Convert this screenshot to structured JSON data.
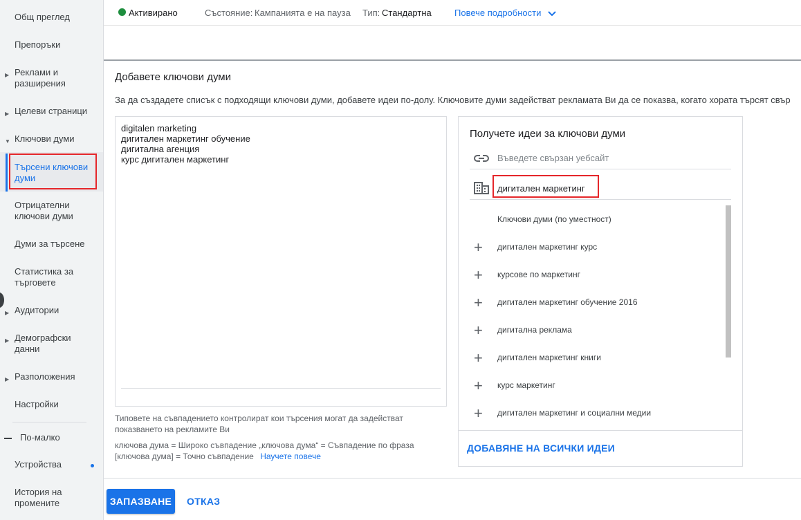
{
  "sidebar": {
    "items": [
      {
        "label": "Общ преглед"
      },
      {
        "label": "Препоръки"
      },
      {
        "label": "Реклами и разширения"
      },
      {
        "label": "Целеви страници"
      },
      {
        "label": "Ключови думи"
      },
      {
        "label": "Търсени ключови думи"
      },
      {
        "label": "Отрицателни ключови думи"
      },
      {
        "label": "Думи за търсене"
      },
      {
        "label": "Статистика за търговете"
      },
      {
        "label": "Аудитории"
      },
      {
        "label": "Демографски данни"
      },
      {
        "label": "Разположения"
      },
      {
        "label": "Настройки"
      },
      {
        "label": "По-малко"
      },
      {
        "label": "Устройства"
      },
      {
        "label": "История на промените"
      }
    ]
  },
  "status_bar": {
    "status": "Активирано",
    "state_label": "Състояние:",
    "state_value": "Кампанията е на пауза",
    "type_label": "Тип:",
    "type_value": "Стандартна",
    "more_details": "Повече подробности"
  },
  "main": {
    "title": "Добавете ключови думи",
    "description": "За да създадете списък с подходящи ключови думи, добавете идеи по-долу. Ключовите думи задействат рекламата Ви да се показва, когато хората търсят свър",
    "keywords": [
      "digitalen marketing",
      "дигитален маркетинг обучение",
      "дигитална агенция",
      "курс дигитален маркетинг"
    ],
    "help_text": "Типовете на съвпадението контролират кои търсения могат да задействат показването на рекламите Ви",
    "match_line1": "ключова дума = Широко съвпадение  „ключова дума“ = Съвпадение по фраза",
    "match_line2": "[ключова дума] = Точно съвпадение",
    "learn_more": "Научете повече"
  },
  "ideas_panel": {
    "title": "Получете идеи за ключови думи",
    "url_placeholder": "Въведете свързан уебсайт",
    "service_value": "дигитален маркетинг",
    "column_header": "Ключови думи (по уместност)",
    "ideas": [
      "дигитален маркетинг курс",
      "курсове по маркетинг",
      "дигитален маркетинг обучение 2016",
      "дигитална реклама",
      "дигитален маркетинг книги",
      "курс маркетинг",
      "дигитален маркетинг и социални медии"
    ],
    "add_all": "ДОБАВЯНЕ НА ВСИЧКИ ИДЕИ"
  },
  "footer": {
    "save": "ЗАПАЗВАНЕ",
    "cancel": "ОТКАЗ"
  },
  "colors": {
    "accent": "#1a73e8",
    "status_green": "#1e8e3e",
    "highlight_red": "#e5262a"
  }
}
